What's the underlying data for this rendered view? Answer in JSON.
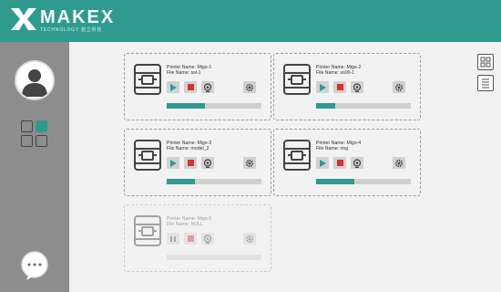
{
  "app": {
    "brand": "MAKEX",
    "tagline": "TECHNOLOGY 創立科技",
    "accent_color": "#2f9b8f"
  },
  "sidebar": {
    "avatar_icon": "user-avatar-icon",
    "dashboard_icon": "grid-icon",
    "chat_icon": "chat-bubble-icon"
  },
  "view_toggles": {
    "grid_icon": "grid-view-icon",
    "list_icon": "list-view-icon"
  },
  "printers": [
    {
      "name_line": "Printer Name: Migo-1",
      "file_line": "File Name: ssl-1",
      "progress": 0.4,
      "state": "printing"
    },
    {
      "name_line": "Printer Name: Migo-2",
      "file_line": "File Name: ss00-1",
      "progress": 0.2,
      "state": "printing"
    },
    {
      "name_line": "Printer Name: Migo-3",
      "file_line": "File Name: model_2",
      "progress": 0.3,
      "state": "printing"
    },
    {
      "name_line": "Printer Name: Migo-4",
      "file_line": "File Name: ring",
      "progress": 0.4,
      "state": "printing"
    },
    {
      "name_line": "Printer Name: Migo-5",
      "file_line": "File Name: NULL",
      "progress": 0.0,
      "state": "offline"
    }
  ]
}
